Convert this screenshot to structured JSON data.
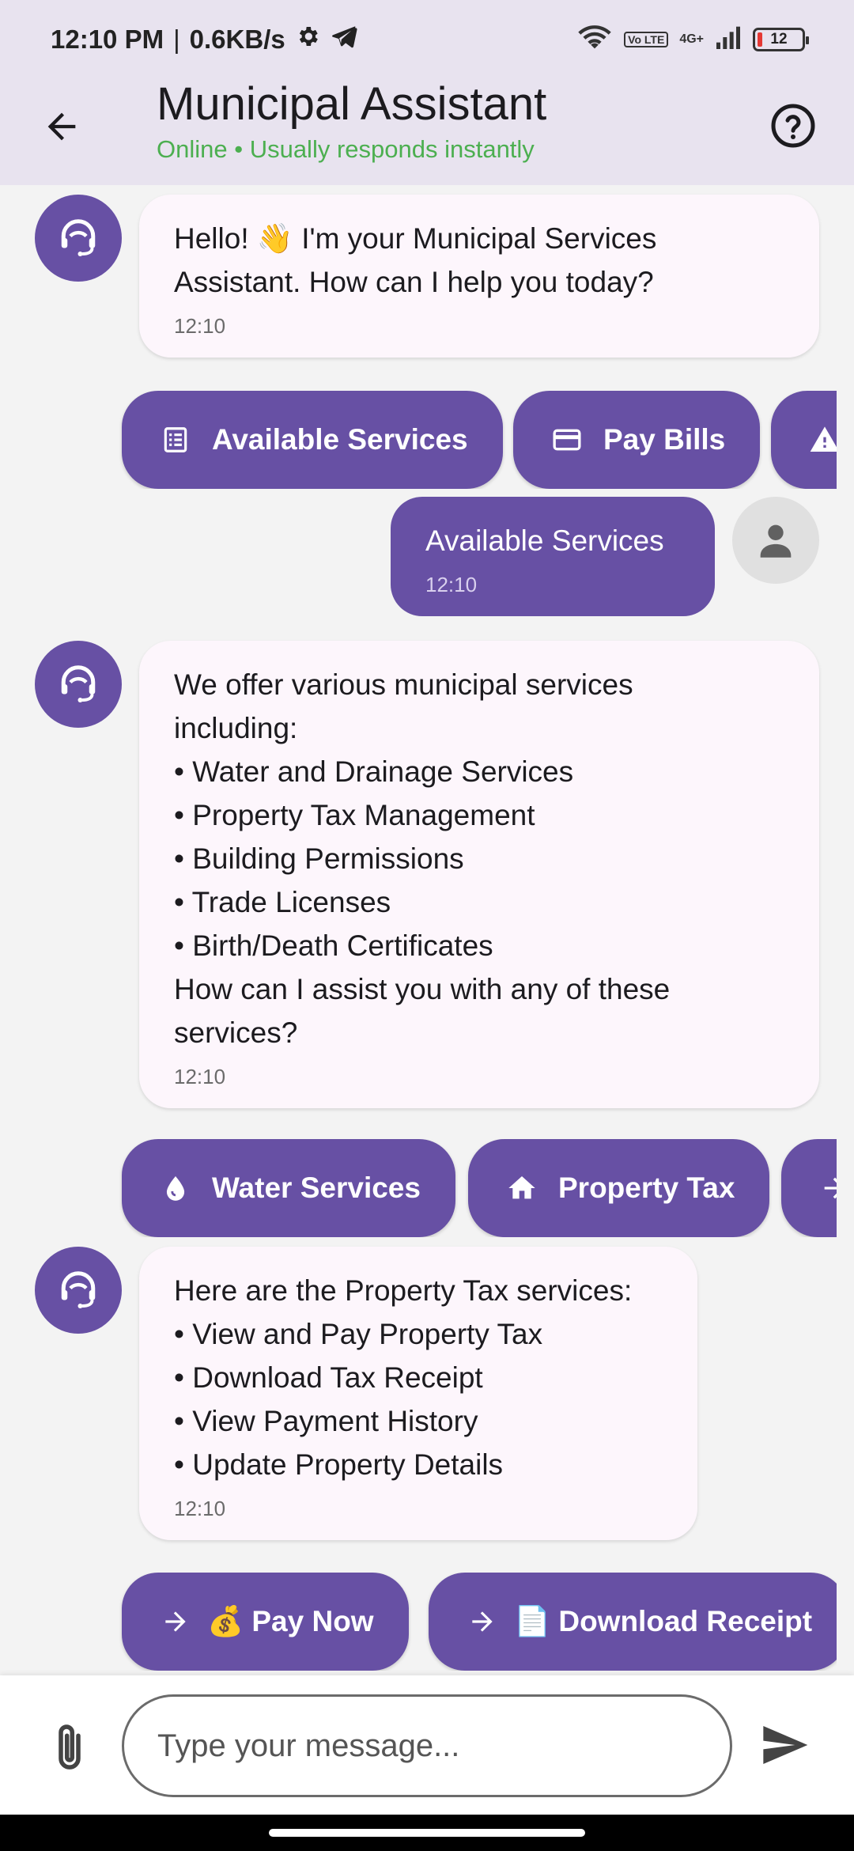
{
  "status_bar": {
    "time": "12:10 PM",
    "separator": "|",
    "speed": "0.6KB/s",
    "network": "4G+",
    "lte": "Vo LTE",
    "battery": "12"
  },
  "header": {
    "title": "Municipal Assistant",
    "subtitle": "Online • Usually responds instantly"
  },
  "messages": [
    {
      "sender": "bot",
      "lines": [
        "Hello! 👋 I'm your Municipal Services",
        "Assistant. How can I help you today?"
      ],
      "time": "12:10"
    },
    {
      "sender": "user",
      "lines": [
        "Available Services"
      ],
      "time": "12:10"
    },
    {
      "sender": "bot",
      "lines": [
        "We offer various municipal services",
        "including:",
        "• Water and Drainage Services",
        "• Property Tax Management",
        "• Building Permissions",
        "• Trade Licenses",
        "• Birth/Death Certificates",
        "How can I assist you with any of these",
        "services?"
      ],
      "time": "12:10"
    },
    {
      "sender": "bot",
      "lines": [
        "Here are the Property Tax services:",
        "• View and Pay Property Tax",
        "• Download Tax Receipt",
        "• View Payment History",
        "• Update Property Details"
      ],
      "time": "12:10"
    }
  ],
  "chips_row1": [
    {
      "label": "Available Services",
      "icon": "list-icon"
    },
    {
      "label": "Pay Bills",
      "icon": "credit-card-icon"
    },
    {
      "label": "",
      "icon": "warning-icon"
    }
  ],
  "chips_row2": [
    {
      "label": "Water Services",
      "icon": "water-drop-icon"
    },
    {
      "label": "Property Tax",
      "icon": "home-icon"
    },
    {
      "label": "",
      "icon": "arrow-right-icon"
    }
  ],
  "chips_row3": [
    {
      "label": "Pay Now",
      "icon": "arrow-right-icon",
      "emoji": "💰"
    },
    {
      "label": "Download Receipt",
      "icon": "arrow-right-icon",
      "emoji": "📄"
    }
  ],
  "input": {
    "placeholder": "Type your message..."
  },
  "colors": {
    "primary": "#6750a4",
    "appbar_bg": "#e8e3ef",
    "online_green": "#4caf50",
    "bot_bubble": "#fdf6fc"
  }
}
